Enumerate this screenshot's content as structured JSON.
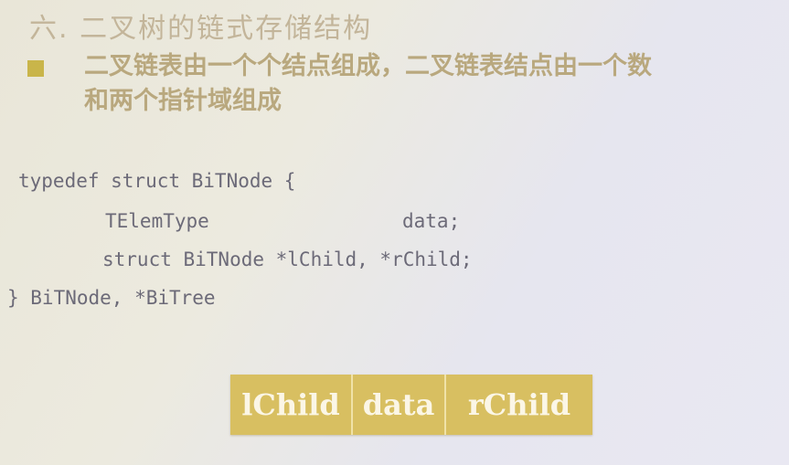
{
  "slide": {
    "title": "六. 二叉树的链式存储结构",
    "bullet": {
      "line1": "二叉链表由一个个结点组成，二叉链表结点由一个数",
      "line2": "和两个指针域组成"
    },
    "code": {
      "line1": "typedef struct BiTNode {",
      "line2": "TElemType",
      "line2_field": "data;",
      "line3": "struct BiTNode *lChild, *rChild;",
      "line4": "} BiTNode, *BiTree"
    },
    "node_fields": [
      "lChild",
      "data",
      "rChild"
    ]
  },
  "colors": {
    "title": "#c3b59a",
    "bullet_text": "#b9a87e",
    "bullet_square": "#c9b54a",
    "code_text": "#6c6a78",
    "node_fill": "#d8bf61",
    "node_text": "#fbf6e6"
  }
}
